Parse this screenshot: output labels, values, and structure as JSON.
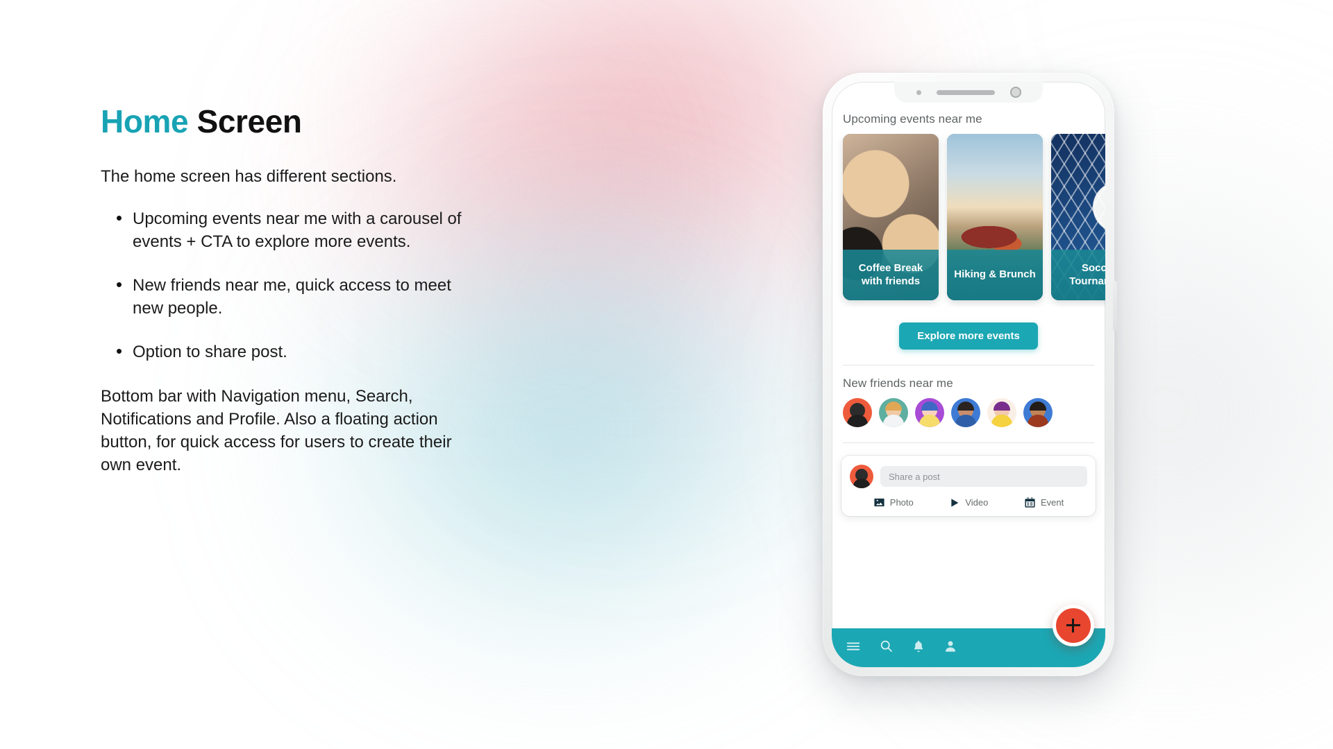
{
  "title": {
    "accent": "Home",
    "rest": "Screen"
  },
  "intro": "The home screen has different sections.",
  "bullets": [
    "Upcoming events near me with a carousel of events + CTA to explore more events.",
    "New friends near me, quick access to meet new people.",
    "Option to share post."
  ],
  "closing": "Bottom bar with Navigation menu, Search, Notifications and Profile. Also a floating action button, for quick access for users to create their own event.",
  "colors": {
    "accent_teal": "#1CA7B4",
    "title_teal": "#18A3B4",
    "fab_red": "#E8462F",
    "heading_gray": "#5F6365"
  },
  "phone": {
    "events_section": {
      "heading": "Upcoming events near me",
      "cards": [
        {
          "title": "Coffee Break with friends",
          "art": "coffee-cups-photo"
        },
        {
          "title": "Hiking & Brunch",
          "art": "hikers-mountain-photo"
        },
        {
          "title": "Soccer Tournament",
          "art": "soccer-net-photo"
        }
      ],
      "cta_label": "Explore more events"
    },
    "friends_section": {
      "heading": "New friends near me",
      "avatars": [
        {
          "name": "avatar-ninja",
          "bg": "#EE5B3C",
          "skin": "#2C2C2C",
          "body": "#1F1F1F"
        },
        {
          "name": "avatar-bearded-man",
          "bg": "#5FAFA0",
          "skin": "#F1C9A5",
          "body": "#F2F4F5"
        },
        {
          "name": "avatar-kid-cap",
          "bg": "#A84CD6",
          "skin": "#FBD2C0",
          "body": "#F6DC6B"
        },
        {
          "name": "avatar-woman-ponytail",
          "bg": "#3E7BD4",
          "skin": "#C98E6B",
          "body": "#2F5FA8"
        },
        {
          "name": "avatar-woman-purple-hair",
          "bg": "#FAEFE6",
          "skin": "#F2C9AE",
          "body": "#F5D23F"
        },
        {
          "name": "avatar-woman-bob",
          "bg": "#3E7BD4",
          "skin": "#C08457",
          "body": "#9C3A20"
        }
      ]
    },
    "composer": {
      "avatar_name": "avatar-ninja",
      "placeholder": "Share a post",
      "value": "",
      "actions": [
        {
          "label": "Photo",
          "icon": "photo-icon"
        },
        {
          "label": "Video",
          "icon": "video-icon"
        },
        {
          "label": "Event",
          "icon": "calendar-icon"
        }
      ]
    },
    "bottom_bar": {
      "items": [
        {
          "name": "menu-icon",
          "label": "Navigation menu"
        },
        {
          "name": "search-icon",
          "label": "Search"
        },
        {
          "name": "notifications-icon",
          "label": "Notifications"
        },
        {
          "name": "profile-icon",
          "label": "Profile"
        }
      ],
      "fab": {
        "name": "add-event-fab",
        "label": "+"
      }
    }
  }
}
